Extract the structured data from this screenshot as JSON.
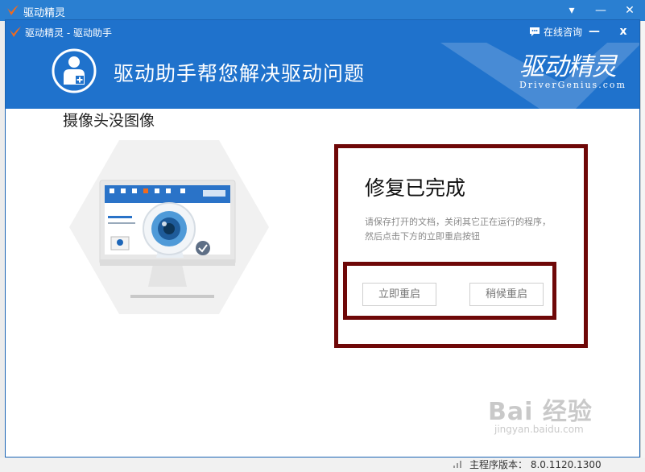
{
  "background_window": {
    "title": "驱动精灵",
    "controls": [
      "dropdown",
      "minimize",
      "close"
    ]
  },
  "dialog": {
    "title": "驱动精灵 - 驱动助手",
    "consult_label": "在线咨询",
    "minimize_label": "—",
    "close_label": "x"
  },
  "banner": {
    "headline": "驱动助手帮您解决驱动问题",
    "brand_cn": "驱动精灵",
    "brand_en": "DriverGenius.com"
  },
  "main": {
    "subtitle": "摄像头没图像",
    "fix_title": "修复已完成",
    "fix_desc_line1": "请保存打开的文档，关闭其它正在运行的程序，",
    "fix_desc_line2": "然后点击下方的立即重启按钮",
    "restart_now": "立即重启",
    "restart_later": "稍候重启"
  },
  "status": {
    "version": "主程序版本：  8.0.1120.1300"
  },
  "watermark": {
    "main": "Bai 经验",
    "sub": "jingyan.baidu.com"
  },
  "colors": {
    "accent_blue": "#1f72cc",
    "highlight_red": "#6f0808",
    "brand_orange": "#f06a1e"
  }
}
